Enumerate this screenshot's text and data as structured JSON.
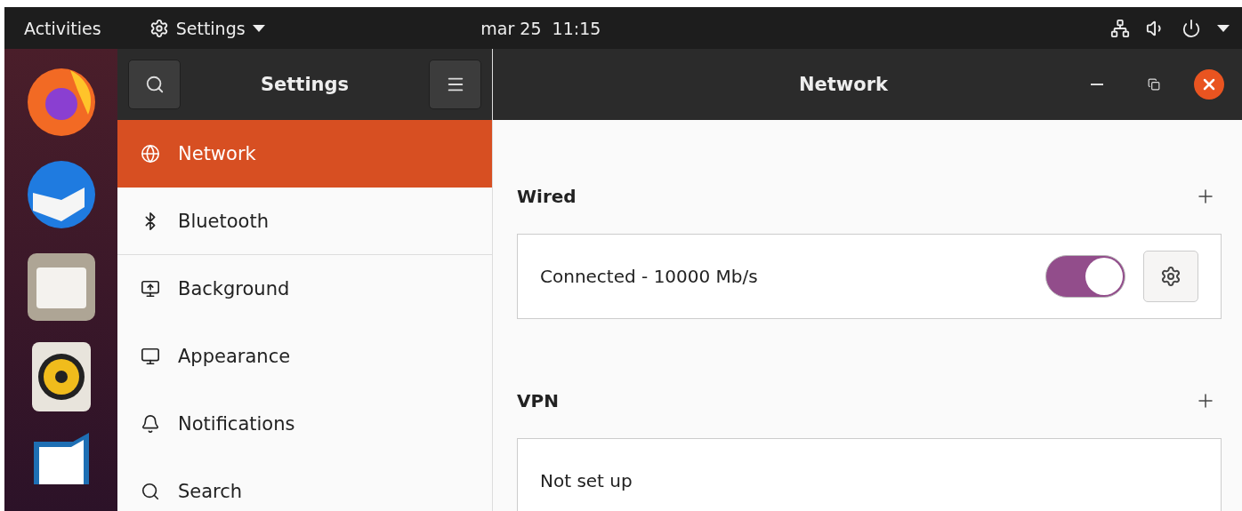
{
  "top_bar": {
    "activities": "Activities",
    "app_menu": "Settings",
    "clock": "mar 25  11:15"
  },
  "sidebar": {
    "title": "Settings",
    "items": [
      {
        "label": "Network",
        "kind": "globe",
        "selected": true
      },
      {
        "label": "Bluetooth",
        "kind": "bluetooth",
        "selected": false
      },
      {
        "label": "Background",
        "kind": "monitor",
        "selected": false
      },
      {
        "label": "Appearance",
        "kind": "appearance",
        "selected": false
      },
      {
        "label": "Notifications",
        "kind": "bell",
        "selected": false
      },
      {
        "label": "Search",
        "kind": "search",
        "selected": false
      }
    ]
  },
  "window": {
    "title": "Network"
  },
  "sections": [
    {
      "title": "Wired",
      "rows": [
        {
          "label": "Connected - 10000 Mb/s",
          "kind": "toggle",
          "on": true
        }
      ]
    },
    {
      "title": "VPN",
      "rows": [
        {
          "label": "Not set up",
          "kind": "text"
        }
      ]
    }
  ]
}
